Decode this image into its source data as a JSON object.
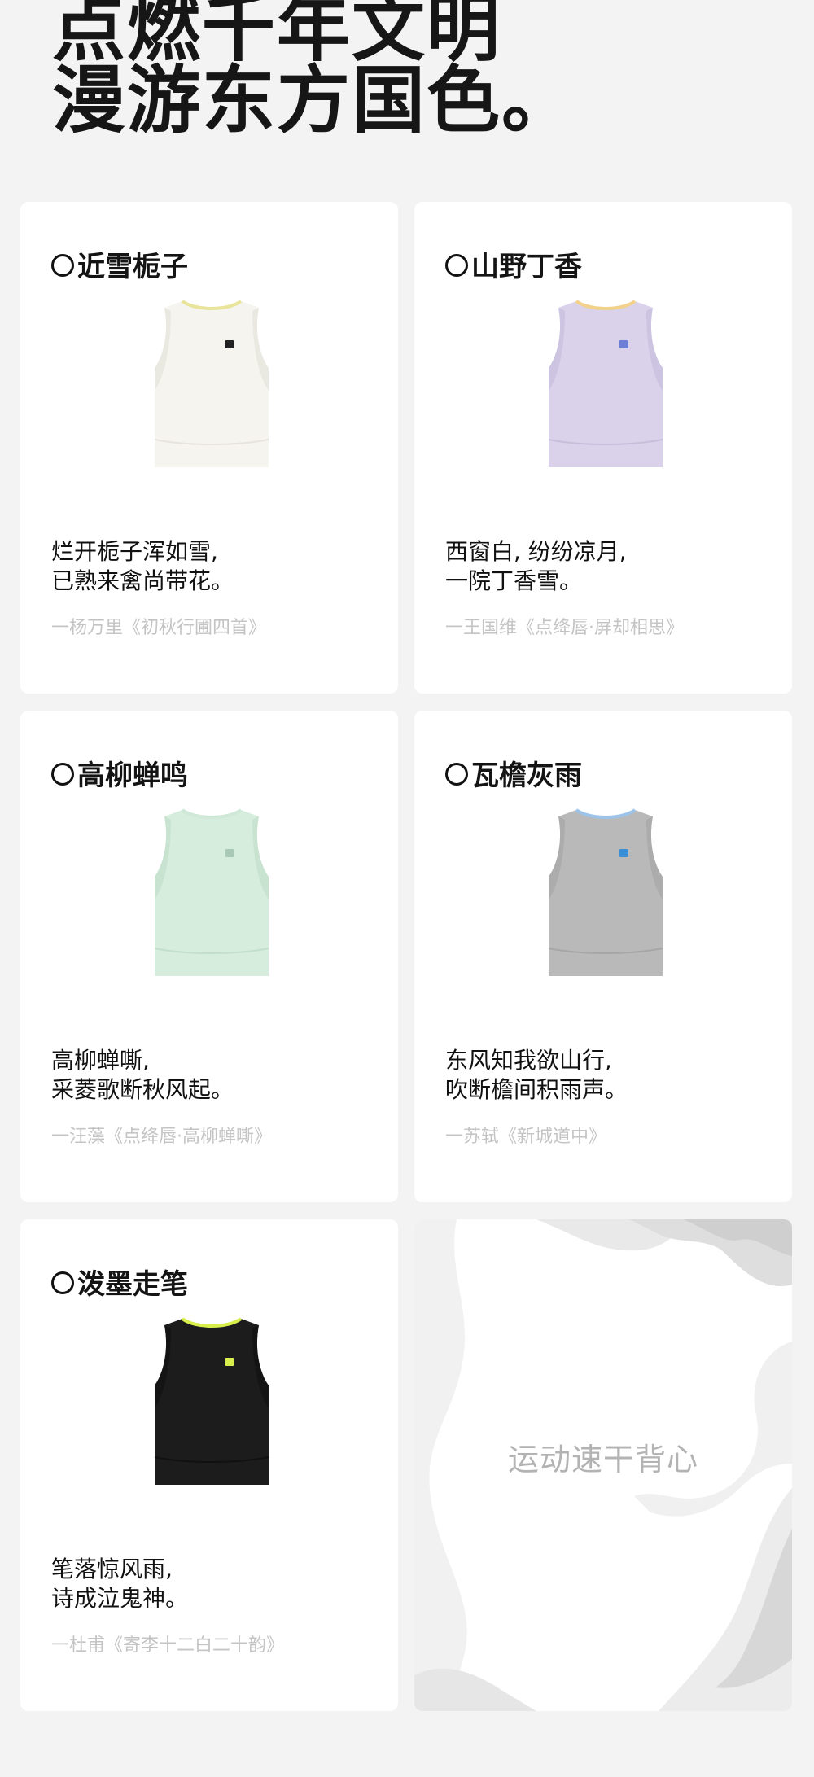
{
  "hero": {
    "line1": "点燃千年文明",
    "line2": "漫游东方国色。"
  },
  "cards": [
    {
      "title": "近雪栀子",
      "poem_line1": "烂开栀子浑如雪,",
      "poem_line2": "已熟来禽尚带花。",
      "source": "一杨万里《初秋行圃四首》",
      "colors": {
        "body": "#f5f4ef",
        "shade": "#e6e4dc",
        "collar": "#e8e49a",
        "logo": "#222222"
      }
    },
    {
      "title": "山野丁香",
      "poem_line1": "西窗白, 纷纷凉月,",
      "poem_line2": "一院丁香雪。",
      "source": "一王国维《点绛唇·屏却相思》",
      "colors": {
        "body": "#d9d2ea",
        "shade": "#c6bedb",
        "collar": "#f2d28a",
        "logo": "#6d7ed6"
      }
    },
    {
      "title": "高柳蝉鸣",
      "poem_line1": "高柳蝉嘶,",
      "poem_line2": "采菱歌断秋风起。",
      "source": "一汪藻《点绛唇·高柳蝉嘶》",
      "colors": {
        "body": "#d6ecdd",
        "shade": "#c2dfcb",
        "collar": "#cfe8d8",
        "logo": "#a9c9b4"
      }
    },
    {
      "title": "瓦檐灰雨",
      "poem_line1": "东风知我欲山行,",
      "poem_line2": "吹断檐间积雨声。",
      "source": "一苏轼《新城道中》",
      "colors": {
        "body": "#b9b9b9",
        "shade": "#a6a6a6",
        "collar": "#9ec3e8",
        "logo": "#3a8fd6"
      }
    },
    {
      "title": "泼墨走笔",
      "poem_line1": "笔落惊风雨,",
      "poem_line2": "诗成泣鬼神。",
      "source": "一杜甫《寄李十二白二十韵》",
      "colors": {
        "body": "#1c1c1c",
        "shade": "#111111",
        "collar": "#d8ee4a",
        "logo": "#d8ee4a"
      }
    }
  ],
  "promo": {
    "label": "运动速干背心"
  }
}
